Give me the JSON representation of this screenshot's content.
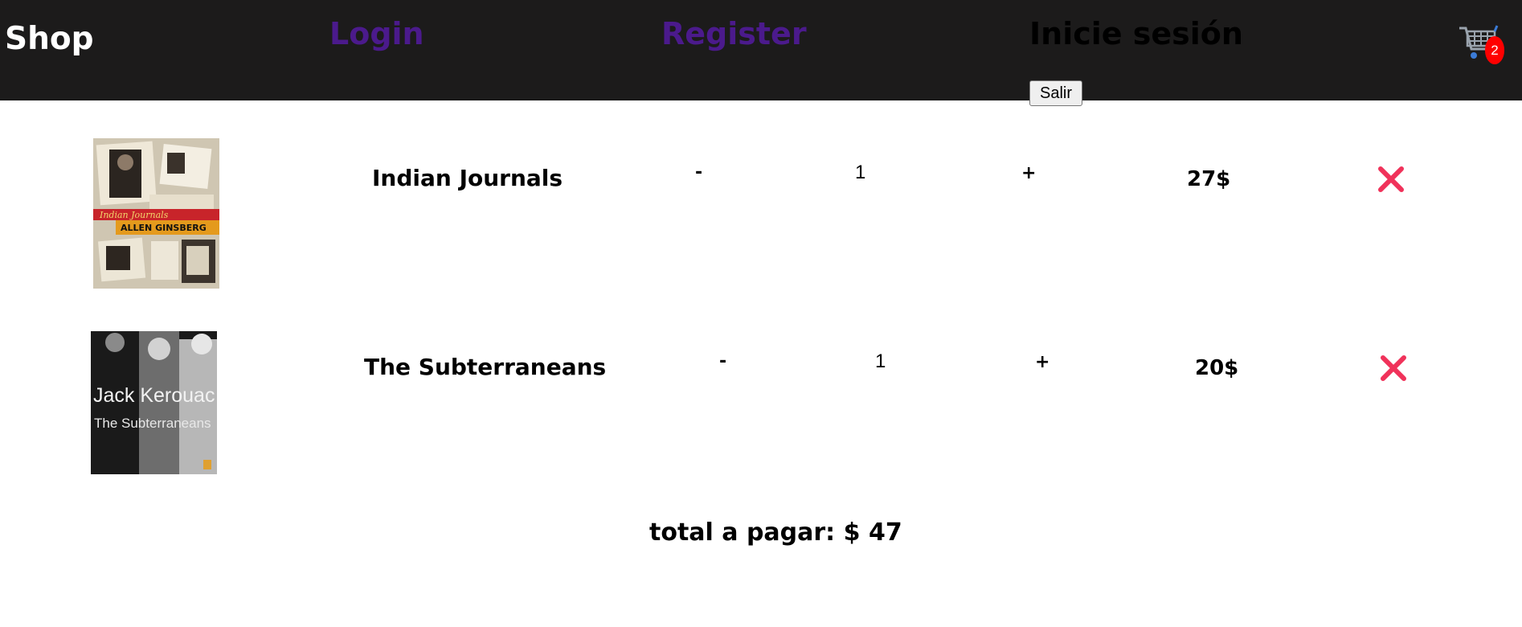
{
  "header": {
    "brand": "Shop",
    "login_label": "Login",
    "register_label": "Register",
    "session_label": "Inicie sesión",
    "logout_label": "Salir",
    "cart_count": "2"
  },
  "cart": {
    "items": [
      {
        "title": "Indian Journals",
        "decrement": "-",
        "quantity": "1",
        "increment": "+",
        "price": "27$",
        "cover_title": "Indian Journals",
        "cover_author": "ALLEN GINSBERG"
      },
      {
        "title": "The Subterraneans",
        "decrement": "-",
        "quantity": "1",
        "increment": "+",
        "price": "20$",
        "cover_author": "Jack Kerouac",
        "cover_title": "The Subterraneans"
      }
    ],
    "total_label": "total a pagar:",
    "total_value": "$ 47"
  },
  "colors": {
    "header_bg": "#1c1b1b",
    "nav_link": "#4b1a8c",
    "remove_icon": "#f0325a",
    "badge": "#ff0000"
  },
  "icons": {
    "cart": "shopping-cart-icon",
    "remove": "close-x-icon"
  }
}
